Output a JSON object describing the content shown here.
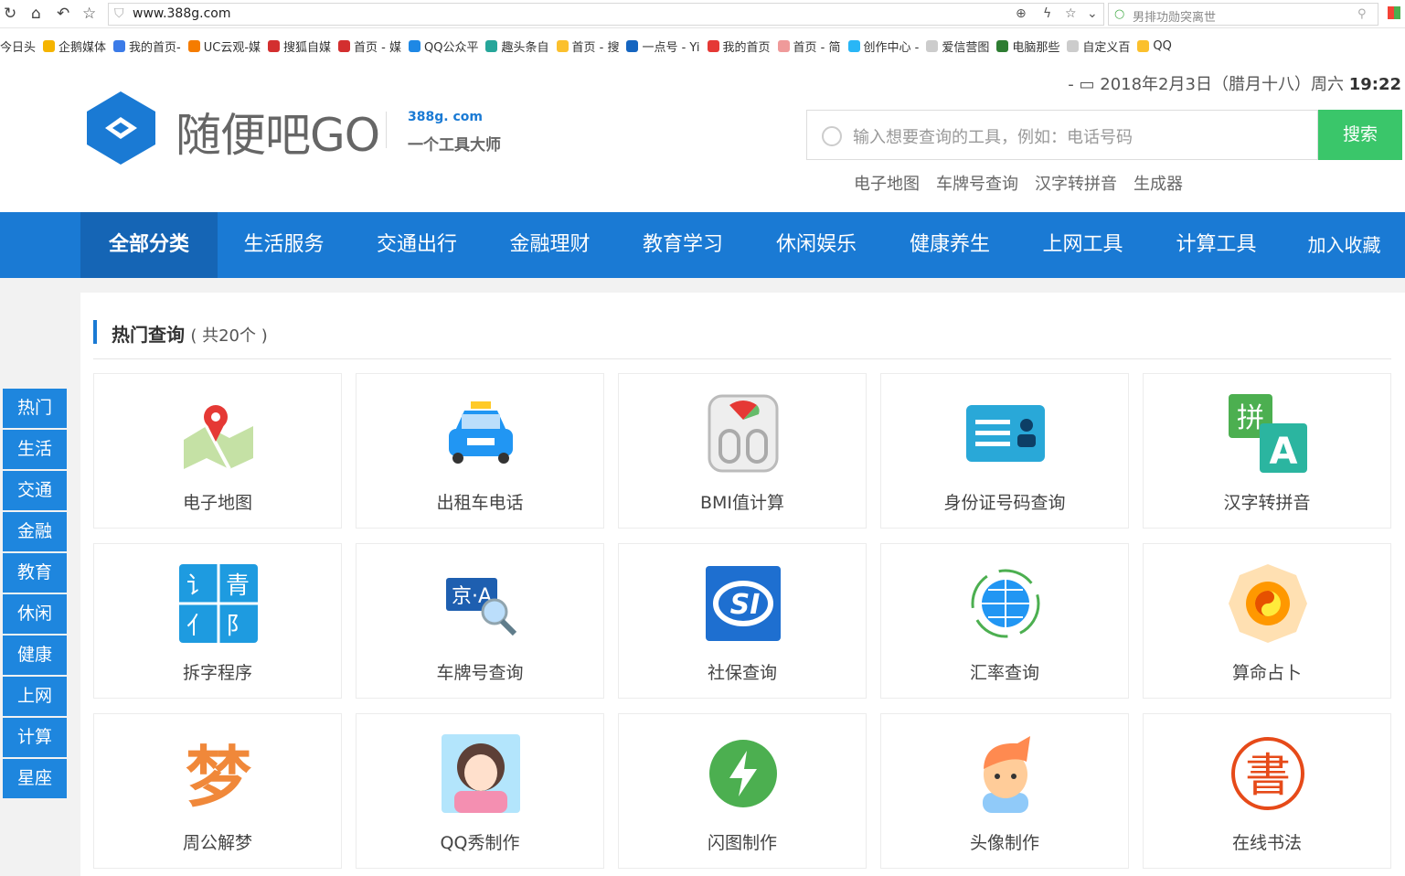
{
  "browser": {
    "url": "www.388g.com",
    "search_placeholder": "男排功勋突离世"
  },
  "bookmarks": [
    {
      "label": "今日头",
      "color": "#ffffff"
    },
    {
      "label": "企鹅媒体",
      "color": "#f5b400"
    },
    {
      "label": "我的首页-",
      "color": "#3b7be8"
    },
    {
      "label": "UC云观-媒",
      "color": "#f57c00"
    },
    {
      "label": "搜狐自媒",
      "color": "#d32f2f"
    },
    {
      "label": "首页 - 媒",
      "color": "#d32f2f"
    },
    {
      "label": "QQ公众平",
      "color": "#1e88e5"
    },
    {
      "label": "趣头条自",
      "color": "#26a69a"
    },
    {
      "label": "首页 - 搜",
      "color": "#fbc02d"
    },
    {
      "label": "一点号 - Yi",
      "color": "#1565c0"
    },
    {
      "label": "我的首页",
      "color": "#e53935"
    },
    {
      "label": "首页 - 简",
      "color": "#ef9a9a"
    },
    {
      "label": "创作中心 -",
      "color": "#29b6f6"
    },
    {
      "label": "爱信营图",
      "color": "#cccccc"
    },
    {
      "label": "电脑那些",
      "color": "#2e7d32"
    },
    {
      "label": "自定义百",
      "color": "#cccccc"
    },
    {
      "label": "QQ",
      "color": "#fbc02d"
    }
  ],
  "header": {
    "date": "2018年2月3日（腊月十八）周六",
    "time": "19:22",
    "logo_text": "随便吧GO",
    "logo_domain": "388g. com",
    "logo_slogan": "一个工具大师",
    "search_placeholder": "输入想要查询的工具，例如：电话号码",
    "search_button": "搜索",
    "hot_links": [
      "电子地图",
      "车牌号查询",
      "汉字转拼音",
      "生成器"
    ]
  },
  "nav": {
    "items": [
      "全部分类",
      "生活服务",
      "交通出行",
      "金融理财",
      "教育学习",
      "休闲娱乐",
      "健康养生",
      "上网工具",
      "计算工具",
      "加入收藏"
    ],
    "active": 0
  },
  "sidebar": [
    "热门",
    "生活",
    "交通",
    "金融",
    "教育",
    "休闲",
    "健康",
    "上网",
    "计算",
    "星座"
  ],
  "section": {
    "title": "热门查询",
    "count": "( 共20个 )"
  },
  "tools": [
    {
      "label": "电子地图",
      "icon": "map-icon",
      "color": "#8bc34a"
    },
    {
      "label": "出租车电话",
      "icon": "taxi-icon",
      "color": "#2196f3"
    },
    {
      "label": "BMI值计算",
      "icon": "scale-icon",
      "color": "#bdbdbd"
    },
    {
      "label": "身份证号码查询",
      "icon": "id-card-icon",
      "color": "#29a8d8"
    },
    {
      "label": "汉字转拼音",
      "icon": "pinyin-icon",
      "color": "#2bb5a0"
    },
    {
      "label": "拆字程序",
      "icon": "split-char-icon",
      "color": "#1e9be0"
    },
    {
      "label": "车牌号查询",
      "icon": "license-plate-icon",
      "color": "#1e5fb0"
    },
    {
      "label": "社保查询",
      "icon": "social-security-icon",
      "color": "#1e6fd0"
    },
    {
      "label": "汇率查询",
      "icon": "exchange-rate-icon",
      "color": "#2196f3"
    },
    {
      "label": "算命占卜",
      "icon": "bagua-icon",
      "color": "#ff9800"
    },
    {
      "label": "周公解梦",
      "icon": "dream-icon",
      "color": "#f0883a"
    },
    {
      "label": "QQ秀制作",
      "icon": "avatar-girl-icon",
      "color": "#f48fb1"
    },
    {
      "label": "闪图制作",
      "icon": "flash-icon",
      "color": "#4caf50"
    },
    {
      "label": "头像制作",
      "icon": "avatar-boy-icon",
      "color": "#ff8a50"
    },
    {
      "label": "在线书法",
      "icon": "calligraphy-icon",
      "color": "#e64a19"
    }
  ]
}
